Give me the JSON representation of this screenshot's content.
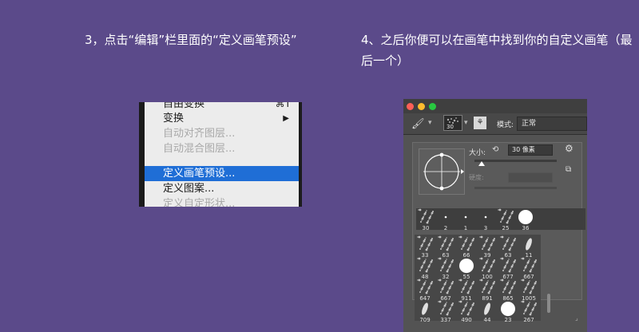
{
  "steps": {
    "step3": "3，点击“编辑”栏里面的“定义画笔预设”",
    "step4": "4、之后你便可以在画笔中找到你的自定义画笔（最后一个）"
  },
  "edit_menu": {
    "items": [
      {
        "label": "自由变换",
        "shortcut": "⌘T",
        "disabled": false
      },
      {
        "label": "变换",
        "submenu": true,
        "disabled": false
      },
      {
        "label": "自动对齐图层...",
        "disabled": true
      },
      {
        "label": "自动混合图层...",
        "disabled": true
      },
      {
        "label": "定义画笔预设...",
        "selected": true,
        "disabled": false
      },
      {
        "label": "定义图案...",
        "disabled": false
      },
      {
        "label": "定义自定形状...",
        "disabled": true
      }
    ]
  },
  "brush_panel": {
    "preset_size": "30",
    "mode_label": "模式:",
    "mode_value": "正常",
    "size_label": "大小:",
    "size_value": "30 像素",
    "size_fraction": 0.03,
    "hardness_label": "硬度:",
    "recent_sizes": [
      "30",
      "2",
      "1",
      "3",
      "25",
      "36"
    ],
    "preset_sizes": [
      "33",
      "63",
      "66",
      "39",
      "63",
      "11",
      "48",
      "32",
      "55",
      "100",
      "677",
      "667",
      "647",
      "667",
      "911",
      "891",
      "865",
      "1005",
      "709",
      "337",
      "490",
      "44",
      "23",
      "267"
    ],
    "colors": {
      "close": "#fe5f57",
      "minimize": "#febc2e",
      "zoom": "#28c840",
      "panel_bg": "#535353"
    },
    "icons": [
      "brush-icon",
      "gear-icon",
      "reset-icon",
      "new-preset-icon"
    ]
  }
}
